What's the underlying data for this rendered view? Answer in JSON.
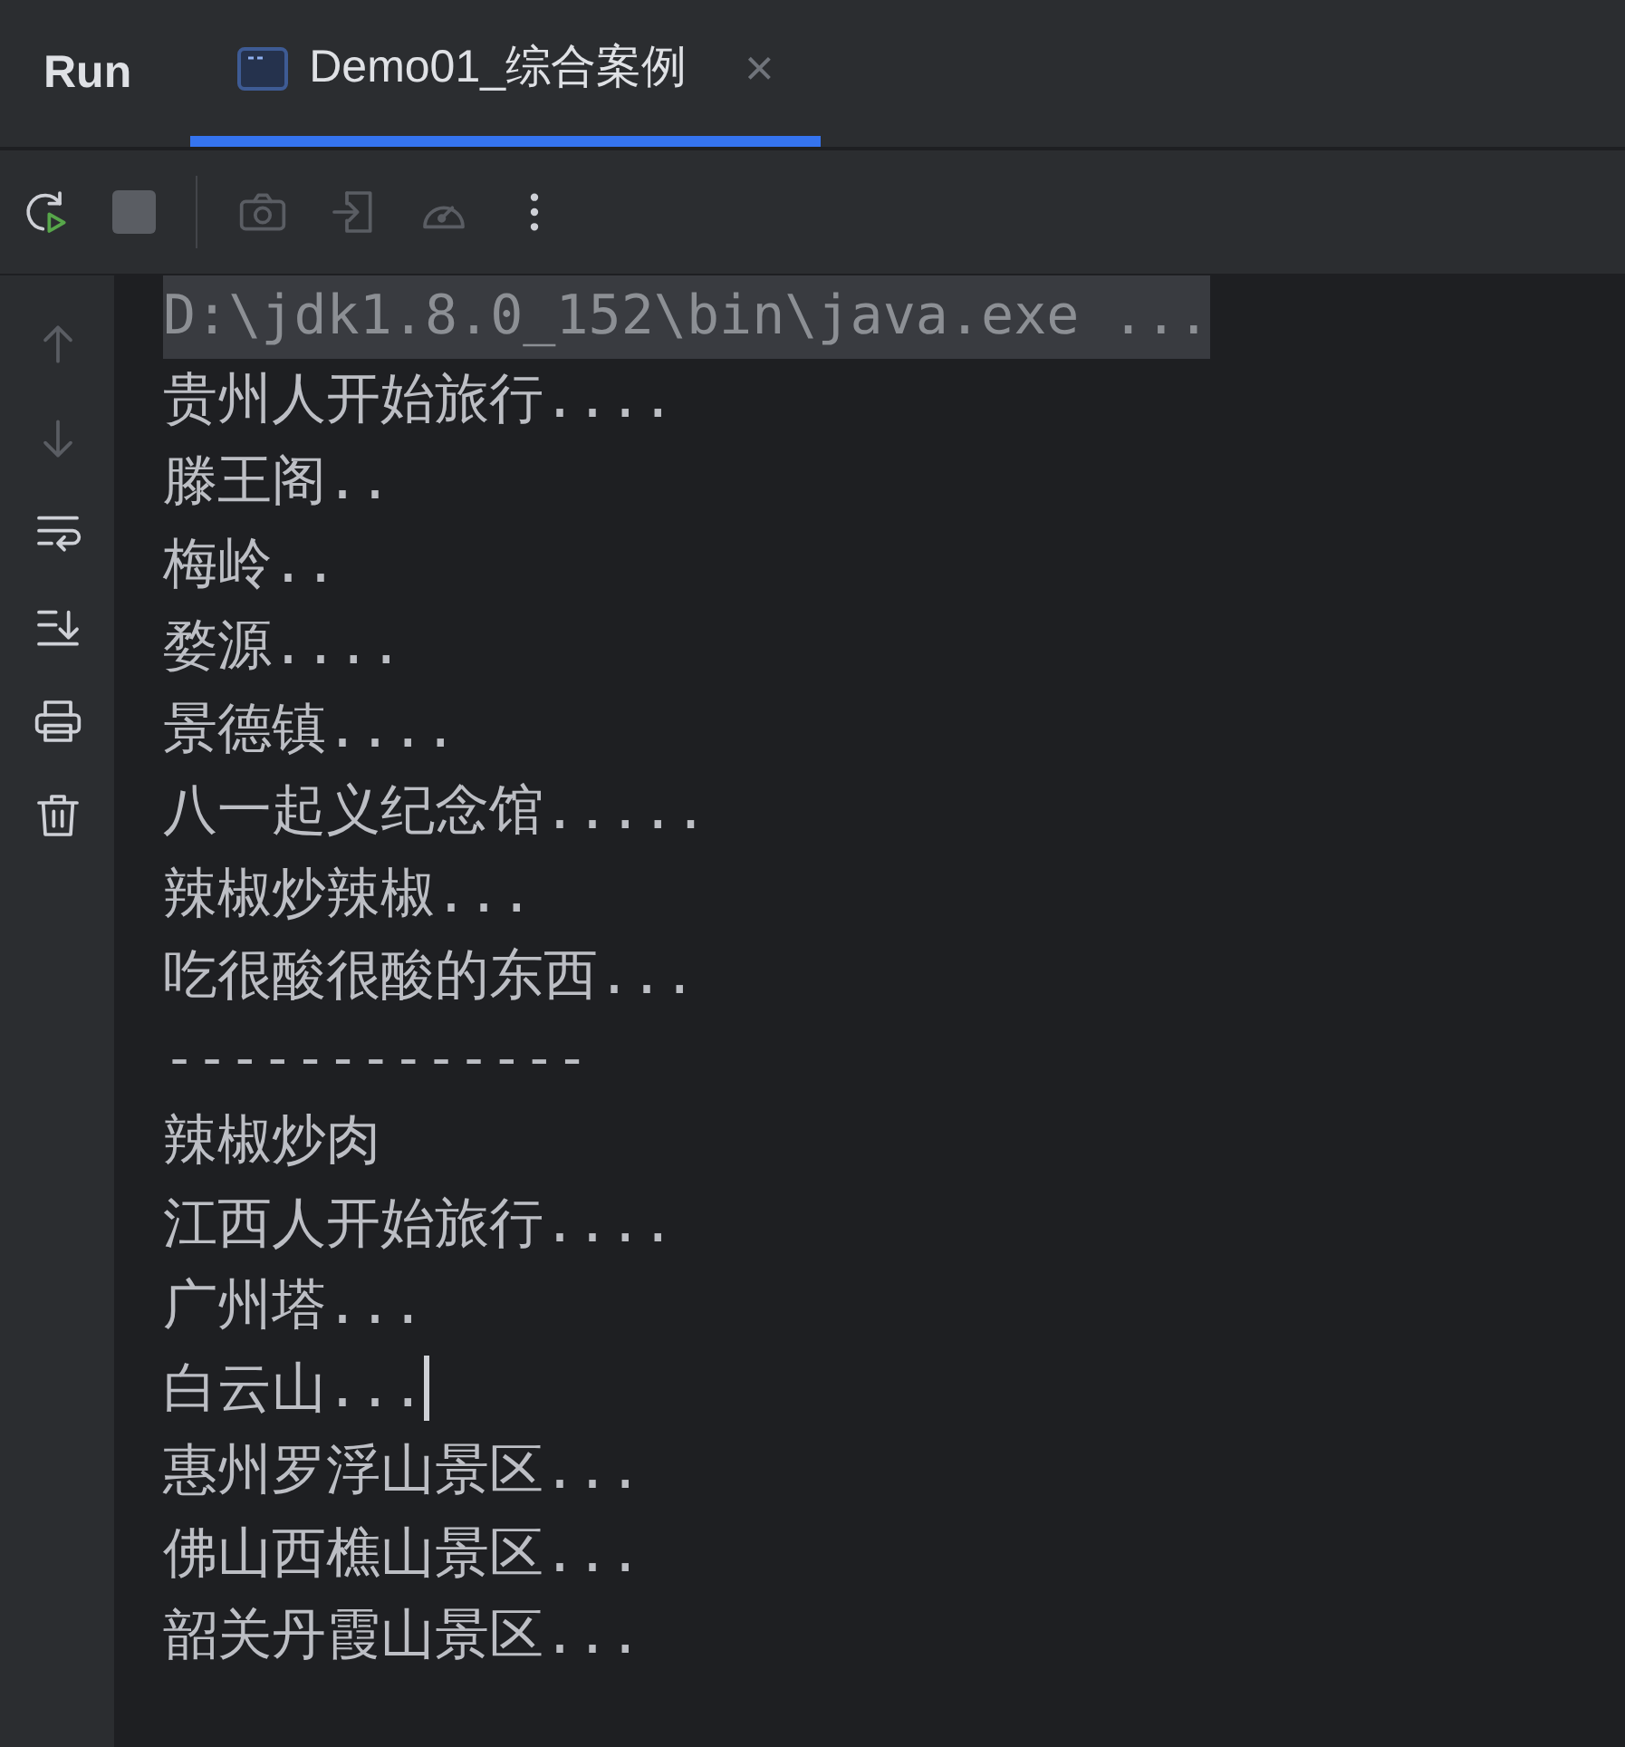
{
  "header": {
    "title": "Run",
    "tabs": [
      {
        "label": "Demo01_综合案例",
        "selected": true,
        "close": "×"
      }
    ]
  },
  "toolbar": [
    {
      "kind": "rerun",
      "disabled": false
    },
    {
      "kind": "stop",
      "disabled": false
    },
    {
      "kind": "separator",
      "disabled": false
    },
    {
      "kind": "camera",
      "disabled": true
    },
    {
      "kind": "exit",
      "disabled": true
    },
    {
      "kind": "gauge",
      "disabled": true
    },
    {
      "kind": "more",
      "disabled": false
    }
  ],
  "gutter": [
    {
      "kind": "up",
      "disabled": true
    },
    {
      "kind": "down",
      "disabled": true
    },
    {
      "kind": "wrap",
      "disabled": false
    },
    {
      "kind": "scroll-end",
      "disabled": false
    },
    {
      "kind": "print",
      "disabled": false
    },
    {
      "kind": "trash",
      "disabled": false
    }
  ],
  "console": [
    {
      "text": "D:\\jdk1.8.0_152\\bin\\java.exe ...",
      "kind": "command",
      "cursor": false
    },
    {
      "text": "贵州人开始旅行....",
      "kind": "output",
      "cursor": false
    },
    {
      "text": "滕王阁..",
      "kind": "output",
      "cursor": false
    },
    {
      "text": "梅岭..",
      "kind": "output",
      "cursor": false
    },
    {
      "text": "婺源....",
      "kind": "output",
      "cursor": false
    },
    {
      "text": "景德镇....",
      "kind": "output",
      "cursor": false
    },
    {
      "text": "八一起义纪念馆.....",
      "kind": "output",
      "cursor": false
    },
    {
      "text": "辣椒炒辣椒...",
      "kind": "output",
      "cursor": false
    },
    {
      "text": "吃很酸很酸的东西...",
      "kind": "output",
      "cursor": false
    },
    {
      "text": "-------------",
      "kind": "output",
      "cursor": false
    },
    {
      "text": "辣椒炒肉",
      "kind": "output",
      "cursor": false
    },
    {
      "text": "江西人开始旅行....",
      "kind": "output",
      "cursor": false
    },
    {
      "text": "广州塔...",
      "kind": "output",
      "cursor": false
    },
    {
      "text": "白云山...",
      "kind": "output",
      "cursor": true
    },
    {
      "text": "惠州罗浮山景区...",
      "kind": "output",
      "cursor": false
    },
    {
      "text": "佛山西樵山景区...",
      "kind": "output",
      "cursor": false
    },
    {
      "text": "韶关丹霞山景区...",
      "kind": "output",
      "cursor": false
    }
  ]
}
